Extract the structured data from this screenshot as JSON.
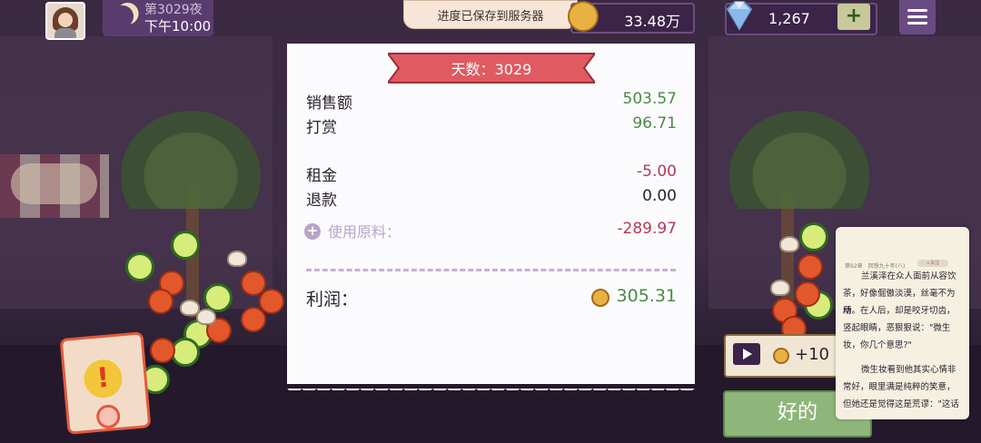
{
  "hud": {
    "night_label": "第3029夜",
    "time_label": "下午10:00",
    "toast": "进度已保存到服务器",
    "coins": "33.48万",
    "gems": "1,267",
    "add_gems": "+"
  },
  "receipt": {
    "title": "天数：3029",
    "rows": [
      {
        "label": "销售额",
        "value": "503.57"
      },
      {
        "label": "打赏",
        "value": "96.71"
      },
      {
        "label": "租金",
        "value": "-5.00"
      },
      {
        "label": "退款",
        "value": "0.00"
      }
    ],
    "ingredients_label": "使用原料：",
    "ingredients_value": "-289.97",
    "profit_label": "利润：",
    "profit_value": "305.31",
    "colors": {
      "positive": "#4c8a45",
      "negative": "#b23a55",
      "title_ribbon": "#e05a62"
    }
  },
  "reward": {
    "amount": "+10",
    "icon": "video-play-icon"
  },
  "ok_button": "好的",
  "novel_overlay": {
    "header": "第92章　回想九十年(八)",
    "pill": "+关注",
    "lines": [
      "兰溪泽在众人面前从容饮",
      "茶，好像倔傲淡漠，丝毫不为所",
      "动。在人后，却是咬牙切齿，",
      "竖起眼睛，恶狠狠说：\"微生",
      "妆，你几个意思?\"",
      "",
      "微生妆看到他其实心情非",
      "常好，眼里满是纯粹的笑意，",
      "但她还是觉得这是荒谬：\"这话"
    ]
  }
}
